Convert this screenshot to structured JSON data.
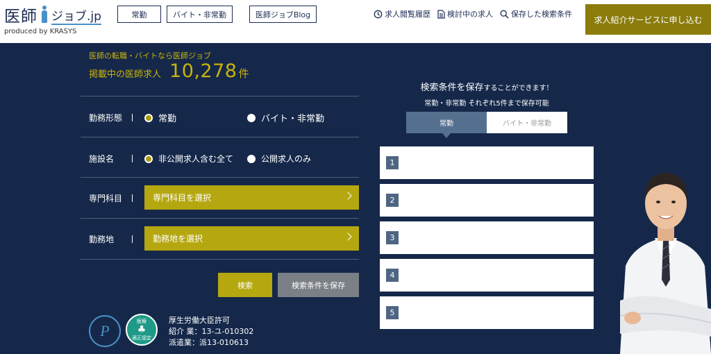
{
  "header": {
    "logo_text": "医師",
    "logo_sub": "ジョブ.jp",
    "logo_producer": "produced by KRASYS",
    "nav": [
      {
        "label": "常勤"
      },
      {
        "label": "バイト・非常勤"
      },
      {
        "label": "医師ジョブBlog"
      }
    ],
    "utility_links": [
      {
        "label": "求人閲覧履歴",
        "icon": "history-icon"
      },
      {
        "label": "検討中の求人",
        "icon": "document-icon"
      },
      {
        "label": "保存した検索条件",
        "icon": "search-icon"
      }
    ],
    "cta_label": "求人紹介サービスに申し込む"
  },
  "main": {
    "tagline": "医師の転職・バイトなら医師ジョブ",
    "count_label": "掲載中の医師求人",
    "count_number": "10,278",
    "count_unit": "件",
    "form": {
      "employment": {
        "label": "勤務形態",
        "options": [
          {
            "label": "常勤",
            "checked": true
          },
          {
            "label": "バイト・非常勤",
            "checked": false
          }
        ]
      },
      "facility": {
        "label": "施設名",
        "options": [
          {
            "label": "非公開求人含む全て",
            "checked": true
          },
          {
            "label": "公開求人のみ",
            "checked": false
          }
        ]
      },
      "specialty": {
        "label": "専門科目",
        "button": "専門科目を選択"
      },
      "location": {
        "label": "勤務地",
        "button": "勤務地を選択"
      },
      "search_button": "検索",
      "save_button": "検索条件を保存"
    },
    "badges": {
      "privacy_mark": "P",
      "green_badge_top": "医療",
      "green_badge_bottom": "適正認定"
    },
    "license": {
      "line1": "厚生労働大臣許可",
      "line2": "紹介 業：13-ユ-010302",
      "line3": "派遣業：派13-010613"
    }
  },
  "saved_search": {
    "title_big": "検索条件を保存",
    "title_rest": "することができます！",
    "subtitle": "常勤・非常勤 それぞれ5件まで保存可能",
    "tabs": [
      {
        "label": "常勤",
        "active": true
      },
      {
        "label": "バイト・非常勤",
        "active": false
      }
    ],
    "slots": [
      "1",
      "2",
      "3",
      "4",
      "5"
    ]
  },
  "colors": {
    "navy": "#15284a",
    "gold": "#b5a70f",
    "cta": "#8b7c0c",
    "slot_badge": "#4e6683"
  }
}
